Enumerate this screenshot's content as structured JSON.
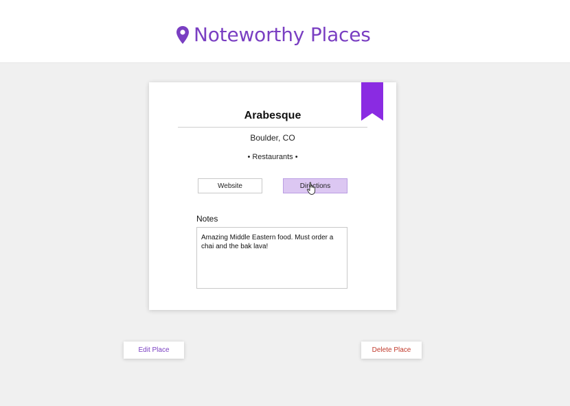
{
  "header": {
    "title": "Noteworthy Places",
    "icon": "map-pin-icon",
    "accent_color": "#7a3fc2"
  },
  "place": {
    "name": "Arabesque",
    "location": "Boulder, CO",
    "category": "• Restaurants •",
    "bookmark_icon": "bookmark-ribbon-icon",
    "bookmark_color": "#8a2be2",
    "buttons": {
      "website_label": "Website",
      "directions_label": "Directions"
    },
    "notes": {
      "label": "Notes",
      "value": "Amazing Middle Eastern food. Must order a chai and the bak lava!"
    }
  },
  "actions": {
    "edit_label": "Edit Place",
    "delete_label": "Delete Place",
    "delete_color": "#c0392b"
  }
}
